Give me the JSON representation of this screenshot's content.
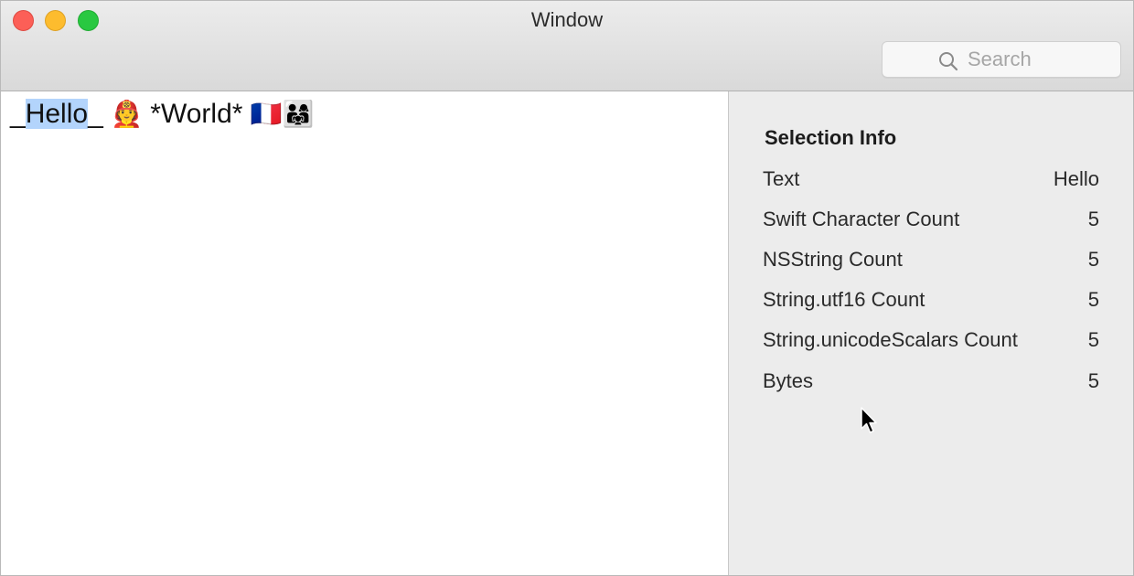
{
  "window": {
    "title": "Window"
  },
  "toolbar": {
    "search_placeholder": "Search"
  },
  "editor": {
    "before_selection": "_",
    "selection": "Hello",
    "after_selection": "_ ",
    "emoji_person": "🧑‍🚒",
    "middle_text": " *World* ",
    "emoji_flag": "🇫🇷",
    "emoji_family": "👨‍👩‍👧"
  },
  "selection_info": {
    "title": "Selection Info",
    "rows": [
      {
        "label": "Text",
        "value": "Hello"
      },
      {
        "label": "Swift Character Count",
        "value": "5"
      },
      {
        "label": "NSString Count",
        "value": "5"
      },
      {
        "label": "String.utf16 Count",
        "value": "5"
      },
      {
        "label": "String.unicodeScalars Count",
        "value": "5"
      },
      {
        "label": "Bytes",
        "value": "5"
      }
    ]
  },
  "colors": {
    "selection_highlight": "#b3d4fc",
    "close": "#fc5f57",
    "minimize": "#fdbc2e",
    "zoom": "#29c841"
  },
  "icons": {
    "search": "magnifying-glass",
    "cursor": "arrow-pointer"
  }
}
